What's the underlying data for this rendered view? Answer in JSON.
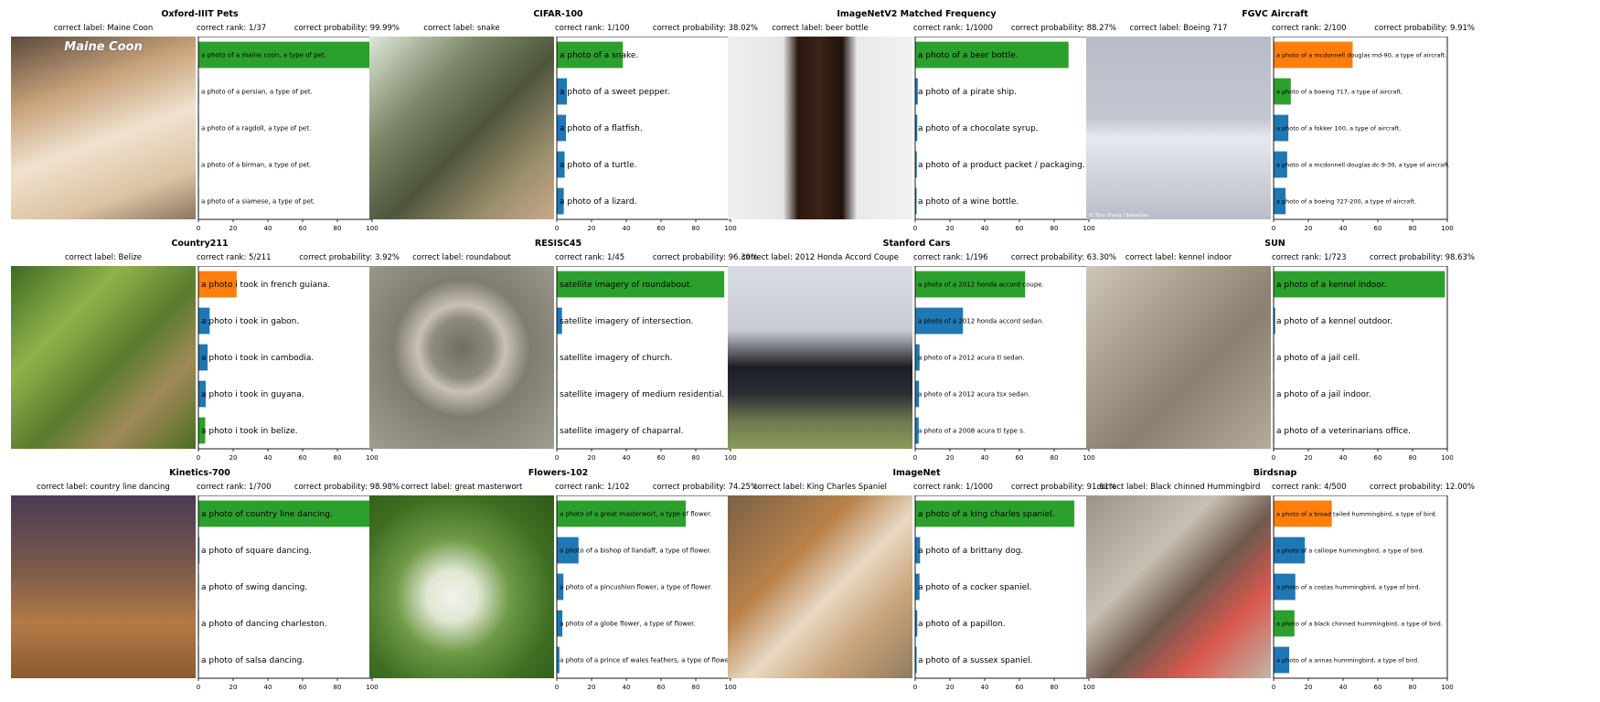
{
  "chart_data": [
    {
      "type": "bar",
      "orientation": "horizontal",
      "title": "Oxford-IIIT Pets",
      "correct_label": "correct label: Maine Coon",
      "correct_rank": "correct rank: 1/37",
      "correct_probability": "correct probability: 99.99%",
      "image_caption": "Maine Coon",
      "categories": [
        "a photo of a maine coon, a type of pet.",
        "a photo of a persian, a type of pet.",
        "a photo of a ragdoll, a type of pet.",
        "a photo of a birman, a type of pet.",
        "a photo of a siamese, a type of pet."
      ],
      "values": [
        99.99,
        0.01,
        0.0,
        0.0,
        0.0
      ],
      "bar_colors": [
        "#2ca02c",
        "#1f77b4",
        "#1f77b4",
        "#1f77b4",
        "#1f77b4"
      ],
      "label_size": 7,
      "xlim": [
        0,
        100
      ],
      "xticks": [
        0,
        20,
        40,
        60,
        80,
        100
      ]
    },
    {
      "type": "bar",
      "orientation": "horizontal",
      "title": "CIFAR-100",
      "correct_label": "correct label: snake",
      "correct_rank": "correct rank: 1/100",
      "correct_probability": "correct probability: 38.02%",
      "categories": [
        "a photo of a snake.",
        "a photo of a sweet pepper.",
        "a photo of a flatfish.",
        "a photo of a turtle.",
        "a photo of a lizard."
      ],
      "values": [
        38.02,
        5.8,
        5.3,
        4.5,
        4.0
      ],
      "bar_colors": [
        "#2ca02c",
        "#1f77b4",
        "#1f77b4",
        "#1f77b4",
        "#1f77b4"
      ],
      "label_size": 9,
      "xlim": [
        0,
        100
      ],
      "xticks": [
        0,
        20,
        40,
        60,
        80,
        100
      ]
    },
    {
      "type": "bar",
      "orientation": "horizontal",
      "title": "ImageNetV2 Matched Frequency",
      "correct_label": "correct label: beer bottle",
      "correct_rank": "correct rank: 1/1000",
      "correct_probability": "correct probability: 88.27%",
      "categories": [
        "a photo of a beer bottle.",
        "a photo of a pirate ship.",
        "a photo of a chocolate syrup.",
        "a photo of a product packet / packaging.",
        "a photo of a wine bottle."
      ],
      "values": [
        88.27,
        1.5,
        1.2,
        0.9,
        0.8
      ],
      "bar_colors": [
        "#2ca02c",
        "#1f77b4",
        "#1f77b4",
        "#1f77b4",
        "#1f77b4"
      ],
      "label_size": 9,
      "xlim": [
        0,
        100
      ],
      "xticks": [
        0,
        20,
        40,
        60,
        80,
        100
      ]
    },
    {
      "type": "bar",
      "orientation": "horizontal",
      "title": "FGVC Aircraft",
      "correct_label": "correct label: Boeing 717",
      "correct_rank": "correct rank: 2/100",
      "correct_probability": "correct probability: 9.91%",
      "image_caption": "© Tony Zhang / Sebastian",
      "categories": [
        "a photo of a mcdonnell douglas md-90, a type of aircraft.",
        "a photo of a boeing 717, a type of aircraft.",
        "a photo of a fokker 100, a type of aircraft.",
        "a photo of a mcdonnell douglas dc-9-30, a type of aircraft.",
        "a photo of a boeing 727-200, a type of aircraft."
      ],
      "values": [
        45.5,
        9.91,
        8.5,
        7.8,
        6.9
      ],
      "bar_colors": [
        "#ff7f0e",
        "#2ca02c",
        "#1f77b4",
        "#1f77b4",
        "#1f77b4"
      ],
      "label_size": 6.5,
      "xlim": [
        0,
        100
      ],
      "xticks": [
        0,
        20,
        40,
        60,
        80,
        100
      ]
    },
    {
      "type": "bar",
      "orientation": "horizontal",
      "title": "Country211",
      "correct_label": "correct label: Belize",
      "correct_rank": "correct rank: 5/211",
      "correct_probability": "correct probability: 3.92%",
      "categories": [
        "a photo i took in french guiana.",
        "a photo i took in gabon.",
        "a photo i took in cambodia.",
        "a photo i took in guyana.",
        "a photo i took in belize."
      ],
      "values": [
        22.0,
        6.5,
        5.3,
        4.2,
        3.92
      ],
      "bar_colors": [
        "#ff7f0e",
        "#1f77b4",
        "#1f77b4",
        "#1f77b4",
        "#2ca02c"
      ],
      "label_size": 9,
      "xlim": [
        0,
        100
      ],
      "xticks": [
        0,
        20,
        40,
        60,
        80,
        100
      ]
    },
    {
      "type": "bar",
      "orientation": "horizontal",
      "title": "RESISC45",
      "correct_label": "correct label: roundabout",
      "correct_rank": "correct rank: 1/45",
      "correct_probability": "correct probability: 96.39%",
      "categories": [
        "satellite imagery of roundabout.",
        "satellite imagery of intersection.",
        "satellite imagery of church.",
        "satellite imagery of medium residential.",
        "satellite imagery of chaparral."
      ],
      "values": [
        96.39,
        3.0,
        0.3,
        0.2,
        0.1
      ],
      "bar_colors": [
        "#2ca02c",
        "#1f77b4",
        "#1f77b4",
        "#1f77b4",
        "#1f77b4"
      ],
      "label_size": 9,
      "xlim": [
        0,
        100
      ],
      "xticks": [
        0,
        20,
        40,
        60,
        80,
        100
      ]
    },
    {
      "type": "bar",
      "orientation": "horizontal",
      "title": "Stanford Cars",
      "correct_label": "correct label: 2012 Honda Accord Coupe",
      "correct_rank": "correct rank: 1/196",
      "correct_probability": "correct probability: 63.30%",
      "categories": [
        "a photo of a 2012 honda accord coupe.",
        "a photo of a 2012 honda accord sedan.",
        "a photo of a 2012 acura tl sedan.",
        "a photo of a 2012 acura tsx sedan.",
        "a photo of a 2008 acura tl type s."
      ],
      "values": [
        63.3,
        27.5,
        2.5,
        2.2,
        2.0
      ],
      "bar_colors": [
        "#2ca02c",
        "#1f77b4",
        "#1f77b4",
        "#1f77b4",
        "#1f77b4"
      ],
      "label_size": 7,
      "xlim": [
        0,
        100
      ],
      "xticks": [
        0,
        20,
        40,
        60,
        80,
        100
      ]
    },
    {
      "type": "bar",
      "orientation": "horizontal",
      "title": "SUN",
      "correct_label": "correct label: kennel indoor",
      "correct_rank": "correct rank: 1/723",
      "correct_probability": "correct probability: 98.63%",
      "categories": [
        "a photo of a kennel indoor.",
        "a photo of a kennel outdoor.",
        "a photo of a jail cell.",
        "a photo of a jail indoor.",
        "a photo of a veterinarians office."
      ],
      "values": [
        98.63,
        0.9,
        0.2,
        0.1,
        0.1
      ],
      "bar_colors": [
        "#2ca02c",
        "#1f77b4",
        "#1f77b4",
        "#1f77b4",
        "#1f77b4"
      ],
      "label_size": 9,
      "xlim": [
        0,
        100
      ],
      "xticks": [
        0,
        20,
        40,
        60,
        80,
        100
      ]
    },
    {
      "type": "bar",
      "orientation": "horizontal",
      "title": "Kinetics-700",
      "correct_label": "correct label: country line dancing",
      "correct_rank": "correct rank: 1/700",
      "correct_probability": "correct probability: 98.98%",
      "categories": [
        "a photo of country line dancing.",
        "a photo of square dancing.",
        "a photo of swing dancing.",
        "a photo of dancing charleston.",
        "a photo of salsa dancing."
      ],
      "values": [
        98.98,
        0.6,
        0.2,
        0.1,
        0.1
      ],
      "bar_colors": [
        "#2ca02c",
        "#1f77b4",
        "#1f77b4",
        "#1f77b4",
        "#1f77b4"
      ],
      "label_size": 9,
      "xlim": [
        0,
        100
      ],
      "xticks": [
        0,
        20,
        40,
        60,
        80,
        100
      ]
    },
    {
      "type": "bar",
      "orientation": "horizontal",
      "title": "Flowers-102",
      "correct_label": "correct label: great masterwort",
      "correct_rank": "correct rank: 1/102",
      "correct_probability": "correct probability: 74.25%",
      "categories": [
        "a photo of a great masterwort, a type of flower.",
        "a photo of a bishop of llandaff, a type of flower.",
        "a photo of a pincushion flower, a type of flower.",
        "a photo of a globe flower, a type of flower.",
        "a photo of a prince of wales feathers, a type of flower."
      ],
      "values": [
        74.25,
        12.5,
        3.8,
        3.2,
        1.5
      ],
      "bar_colors": [
        "#2ca02c",
        "#1f77b4",
        "#1f77b4",
        "#1f77b4",
        "#1f77b4"
      ],
      "label_size": 7,
      "xlim": [
        0,
        100
      ],
      "xticks": [
        0,
        20,
        40,
        60,
        80,
        100
      ]
    },
    {
      "type": "bar",
      "orientation": "horizontal",
      "title": "ImageNet",
      "correct_label": "correct label: King Charles Spaniel",
      "correct_rank": "correct rank: 1/1000",
      "correct_probability": "correct probability: 91.61%",
      "categories": [
        "a photo of a king charles spaniel.",
        "a photo of a brittany dog.",
        "a photo of a cocker spaniel.",
        "a photo of a papillon.",
        "a photo of a sussex spaniel."
      ],
      "values": [
        91.61,
        2.8,
        2.5,
        1.2,
        0.8
      ],
      "bar_colors": [
        "#2ca02c",
        "#1f77b4",
        "#1f77b4",
        "#1f77b4",
        "#1f77b4"
      ],
      "label_size": 9,
      "xlim": [
        0,
        100
      ],
      "xticks": [
        0,
        20,
        40,
        60,
        80,
        100
      ]
    },
    {
      "type": "bar",
      "orientation": "horizontal",
      "title": "Birdsnap",
      "correct_label": "correct label: Black chinned Hummingbird",
      "correct_rank": "correct rank: 4/500",
      "correct_probability": "correct probability: 12.00%",
      "categories": [
        "a photo of a broad tailed hummingbird, a type of bird.",
        "a photo of a calliope hummingbird, a type of bird.",
        "a photo of a costas hummingbird, a type of bird.",
        "a photo of a black chinned hummingbird, a type of bird.",
        "a photo of a annas hummingbird, a type of bird."
      ],
      "values": [
        33.5,
        18.0,
        12.5,
        12.0,
        9.0
      ],
      "bar_colors": [
        "#ff7f0e",
        "#1f77b4",
        "#1f77b4",
        "#2ca02c",
        "#1f77b4"
      ],
      "label_size": 6.5,
      "xlim": [
        0,
        100
      ],
      "xticks": [
        0,
        20,
        40,
        60,
        80,
        100
      ]
    }
  ],
  "thumbnails": [
    {
      "name": "pets-maine-coon-photo",
      "bg": "linear-gradient(160deg,#5a4a3e 0%,#c8a27a 30%,#efe2cf 55%,#dcc3a3 80%,#8d7560 100%)"
    },
    {
      "name": "cifar-snake-photo",
      "bg": "linear-gradient(135deg,#dfe7d8 0%,#7d8a6a 30%,#4e553d 55%,#9b8f6d 80%,#c9a98a 100%)"
    },
    {
      "name": "beer-bottle-photo",
      "bg": "linear-gradient(90deg,#eeeeee 0%,#e6e6e6 30%,#2a1810 38%,#3b2418 50%,#1f120c 62%,#e9e9e9 70%,#f2f2f2 100%)"
    },
    {
      "name": "boeing-717-photo",
      "bg": "linear-gradient(180deg,#b7bcc8 0%,#c3c7d1 45%,#e7e8ee 55%,#b9bdc8 100%)"
    },
    {
      "name": "belize-lizard-photo",
      "bg": "linear-gradient(135deg,#3f6a22 0%,#8fb34a 30%,#5a7b2e 55%,#a08a58 75%,#4d6c25 100%)"
    },
    {
      "name": "roundabout-satellite-photo",
      "bg": "radial-gradient(circle at 50% 45%,#6f6e63 0%,#8e8b7e 22%,#c7c2b5 32%,#7f7d6f 50%,#a09e90 100%)"
    },
    {
      "name": "honda-accord-photo",
      "bg": "linear-gradient(180deg,#d8dce3 0%,#c9ccd2 35%,#1d1f24 55%,#2b2e34 70%,#6f7a50 85%,#8a9a5c 100%)"
    },
    {
      "name": "kennel-indoor-photo",
      "bg": "linear-gradient(135deg,#cfc6b8 0%,#a79b8a 35%,#8a7f70 60%,#b6ab9b 100%)"
    },
    {
      "name": "line-dancing-photo",
      "bg": "linear-gradient(180deg,#4a3a55 0%,#7b5a4a 40%,#b37a46 70%,#8a5a32 100%)"
    },
    {
      "name": "masterwort-flowers-photo",
      "bg": "radial-gradient(circle at 45% 55%,#f2f2ee 0%,#dfe6d2 18%,#6f9a46 40%,#3f6e22 70%,#2e5a1a 100%)"
    },
    {
      "name": "spaniel-photo",
      "bg": "linear-gradient(135deg,#7a6148 0%,#b9824b 35%,#e9d9c4 55%,#c9a47a 75%,#8e7b62 100%)"
    },
    {
      "name": "hummingbird-photo",
      "bg": "linear-gradient(135deg,#9a9386 0%,#c8c0b2 35%,#6e5a4e 55%,#d9584e 75%,#bfb6a6 100%)"
    }
  ],
  "colors": {
    "correct": "#2ca02c",
    "top_wrong": "#ff7f0e",
    "other": "#1f77b4"
  }
}
